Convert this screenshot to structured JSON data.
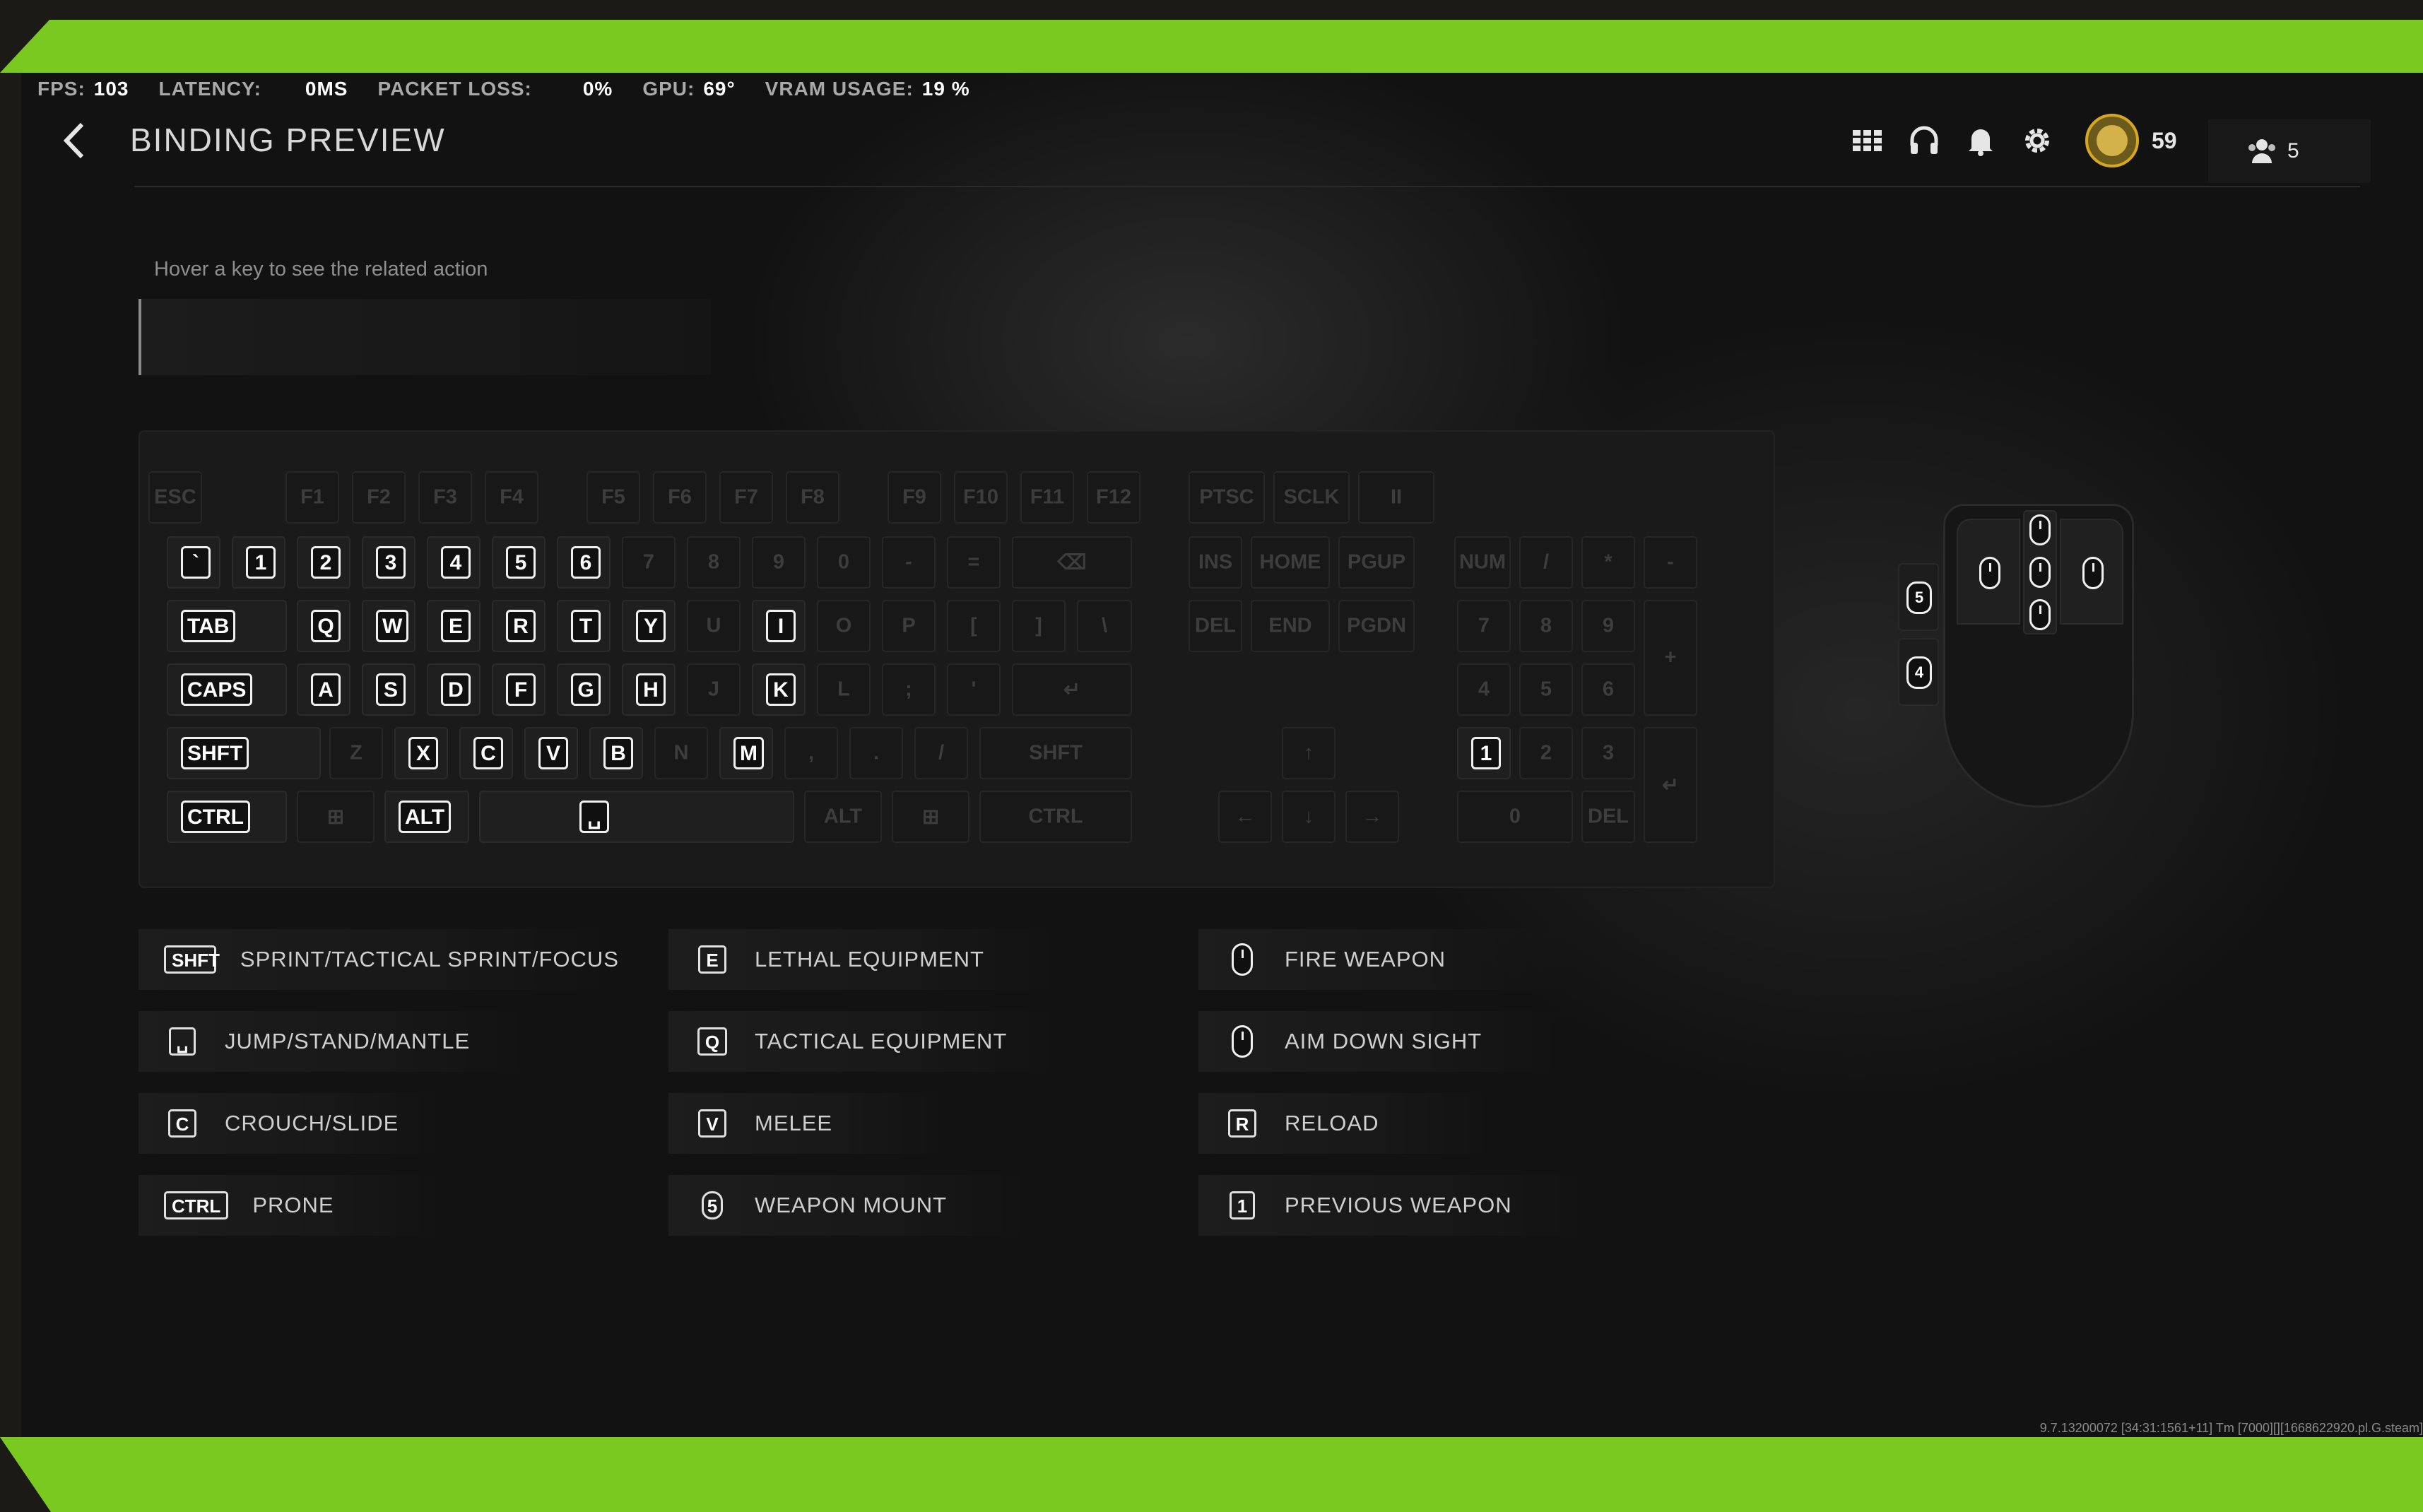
{
  "stats": [
    {
      "label": "FPS:",
      "value": "103"
    },
    {
      "label": "LATENCY:",
      "value": "0MS"
    },
    {
      "label": "PACKET LOSS:",
      "value": "0%"
    },
    {
      "label": "GPU:",
      "value": "69°"
    },
    {
      "label": "VRAM USAGE:",
      "value": "19 %"
    }
  ],
  "header": {
    "title": "BINDING PREVIEW",
    "coins": "59",
    "friends_online": "5",
    "icons": [
      "grid-icon",
      "headset-icon",
      "bell-icon",
      "gear-icon"
    ]
  },
  "hint": "Hover a key to see the related action",
  "keyboard": {
    "rows": [
      [
        "ESC",
        "F1",
        "F2",
        "F3",
        "F4",
        "F5",
        "F6",
        "F7",
        "F8",
        "F9",
        "F10",
        "F11",
        "F12",
        "PTSC",
        "SCLK",
        "II"
      ],
      [
        "`",
        "1",
        "2",
        "3",
        "4",
        "5",
        "6",
        "7",
        "8",
        "9",
        "0",
        "-",
        "=",
        "⌫",
        "INS",
        "HOME",
        "PGUP",
        "NUM",
        "/",
        "*",
        "-"
      ],
      [
        "TAB",
        "Q",
        "W",
        "E",
        "R",
        "T",
        "Y",
        "U",
        "I",
        "O",
        "P",
        "[",
        "]",
        "\\",
        "DEL",
        "END",
        "PGDN",
        "7",
        "8",
        "9",
        "+"
      ],
      [
        "CAPS",
        "A",
        "S",
        "D",
        "F",
        "G",
        "H",
        "J",
        "K",
        "L",
        ";",
        "'",
        "↵",
        "4",
        "5",
        "6"
      ],
      [
        "SHFT",
        "Z",
        "X",
        "C",
        "V",
        "B",
        "N",
        "M",
        ",",
        ".",
        "/",
        "SHFT",
        "↑",
        "1",
        "2",
        "3",
        "↵"
      ],
      [
        "CTRL",
        "⊞",
        "ALT",
        "␣",
        "ALT",
        "⊞",
        "CTRL",
        "←",
        "↓",
        "→",
        "0",
        "DEL"
      ]
    ],
    "active_keys": [
      "`",
      "1",
      "2",
      "3",
      "4",
      "5",
      "6",
      "TAB",
      "Q",
      "W",
      "E",
      "R",
      "T",
      "Y",
      "I",
      "CAPS",
      "A",
      "S",
      "D",
      "F",
      "G",
      "H",
      "K",
      "SHFT",
      "X",
      "C",
      "V",
      "B",
      "M",
      "CTRL",
      "ALT",
      "␣",
      "1 (numpad)"
    ]
  },
  "mouse": {
    "side_buttons": [
      "5",
      "4"
    ]
  },
  "legend": [
    {
      "key": "SHFT",
      "action": "SPRINT/TACTICAL SPRINT/FOCUS"
    },
    {
      "key": "␣",
      "action": "JUMP/STAND/MANTLE"
    },
    {
      "key": "C",
      "action": "CROUCH/SLIDE"
    },
    {
      "key": "CTRL",
      "action": "PRONE"
    },
    {
      "key": "E",
      "action": "LETHAL EQUIPMENT"
    },
    {
      "key": "Q",
      "action": "TACTICAL EQUIPMENT"
    },
    {
      "key": "V",
      "action": "MELEE"
    },
    {
      "key": "5",
      "action": "WEAPON MOUNT"
    },
    {
      "key": "mouse-left",
      "action": "FIRE WEAPON"
    },
    {
      "key": "mouse-right",
      "action": "AIM DOWN SIGHT"
    },
    {
      "key": "R",
      "action": "RELOAD"
    },
    {
      "key": "1",
      "action": "PREVIOUS WEAPON"
    }
  ],
  "build_info": "9.7.13200072 [34:31:1561+11] Tm [7000][][1668622920.pl.G.steam]",
  "colors": {
    "accent": "#7ac920",
    "background": "#121212",
    "key_active": "#ffffff"
  }
}
